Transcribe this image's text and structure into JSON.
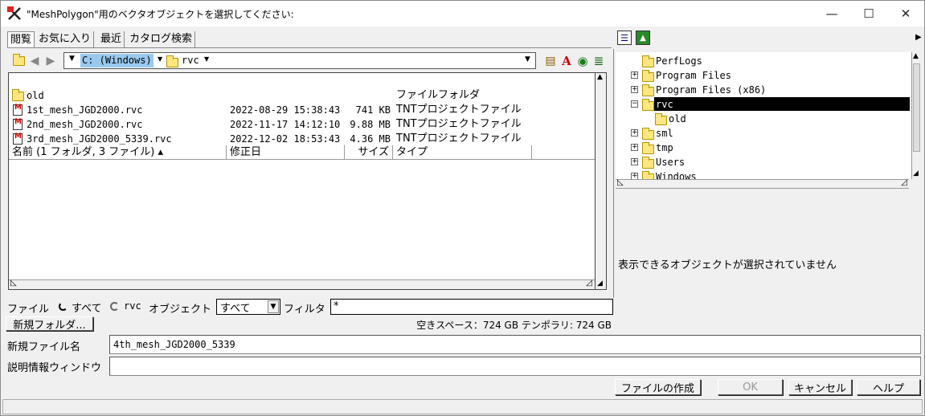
{
  "window": {
    "title": "\"MeshPolygon\"用のベクタオブジェクトを選択してください:",
    "minimize": "—",
    "maximize": "☐",
    "close": "✕"
  },
  "tabs": [
    "閲覧",
    "お気に入り",
    "最近",
    "カタログ検索"
  ],
  "path": {
    "drive": "C: (Windows)",
    "folder": "rvc"
  },
  "list": {
    "columns": {
      "name": "名前  (1 フォルダ, 3 ファイル) ▴",
      "modified": "修正日",
      "size": "サイズ",
      "type": "タイプ"
    },
    "rows": [
      {
        "name": "old",
        "modified": "",
        "size": "",
        "type": "ファイルフォルダ",
        "icon": "folder-icon"
      },
      {
        "name": "1st_mesh_JGD2000.rvc",
        "modified": "2022-08-29 15:38:43",
        "size": "741 KB",
        "type": "TNTプロジェクトファイル",
        "icon": "rvc-file-icon"
      },
      {
        "name": "2nd_mesh_JGD2000.rvc",
        "modified": "2022-11-17 14:12:10",
        "size": "9.88 MB",
        "type": "TNTプロジェクトファイル",
        "icon": "rvc-file-icon"
      },
      {
        "name": "3rd_mesh_JGD2000_5339.rvc",
        "modified": "2022-12-02 18:53:43",
        "size": "4.36 MB",
        "type": "TNTプロジェクトファイル",
        "icon": "rvc-file-icon"
      }
    ]
  },
  "tree": {
    "items": [
      {
        "label": "PerfLogs",
        "expander": ""
      },
      {
        "label": "Program Files",
        "expander": "+"
      },
      {
        "label": "Program Files (x86)",
        "expander": "+"
      },
      {
        "label": "rvc",
        "expander": "−",
        "selected": true
      },
      {
        "label": "old",
        "expander": "",
        "indent": true
      },
      {
        "label": "sml",
        "expander": "+"
      },
      {
        "label": "tmp",
        "expander": "+"
      },
      {
        "label": "Users",
        "expander": "+"
      },
      {
        "label": "Windows",
        "expander": "+"
      }
    ]
  },
  "filter_bar": {
    "file_label": "ファイル",
    "all_label": "すべて",
    "rvc_label": "rvc",
    "object_label": "オブジェクト",
    "object_value": "すべて",
    "filter_label": "フィルタ",
    "filter_value": "*"
  },
  "new_folder_button": "新規フォルダ...",
  "free_space": "空きスペース：724 GB  テンポラリ: 724 GB",
  "preview_message": "表示できるオブジェクトが選択されていません",
  "new_file": {
    "label": "新規ファイル名",
    "value": "4th_mesh_JGD2000_5339"
  },
  "description": {
    "label": "説明情報ウィンドウ",
    "value": ""
  },
  "buttons": {
    "create": "ファイルの作成",
    "ok": "OK",
    "cancel": "キャンセル",
    "help": "ヘルプ"
  },
  "colors": {
    "selection": "#000000",
    "drive_highlight": "#99c9ef",
    "accent": "#ffe680"
  }
}
